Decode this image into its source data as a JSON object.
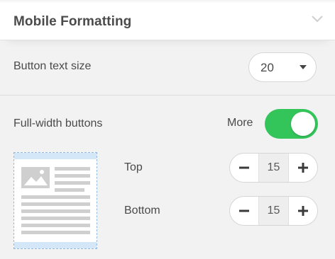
{
  "header": {
    "title": "Mobile Formatting",
    "collapse_icon": "chevron-down-icon"
  },
  "button_text_size": {
    "label": "Button text size",
    "value": "20",
    "dropdown_icon": "caret-down-icon"
  },
  "full_width_buttons": {
    "label": "Full-width buttons",
    "more_label": "More",
    "toggle_on": true,
    "toggle_color": "#33c45a"
  },
  "padding": {
    "preview_icon": "layout-preview-icon",
    "top": {
      "label": "Top",
      "value": "15"
    },
    "bottom": {
      "label": "Bottom",
      "value": "15"
    },
    "decrement_icon": "minus-icon",
    "increment_icon": "plus-icon"
  }
}
